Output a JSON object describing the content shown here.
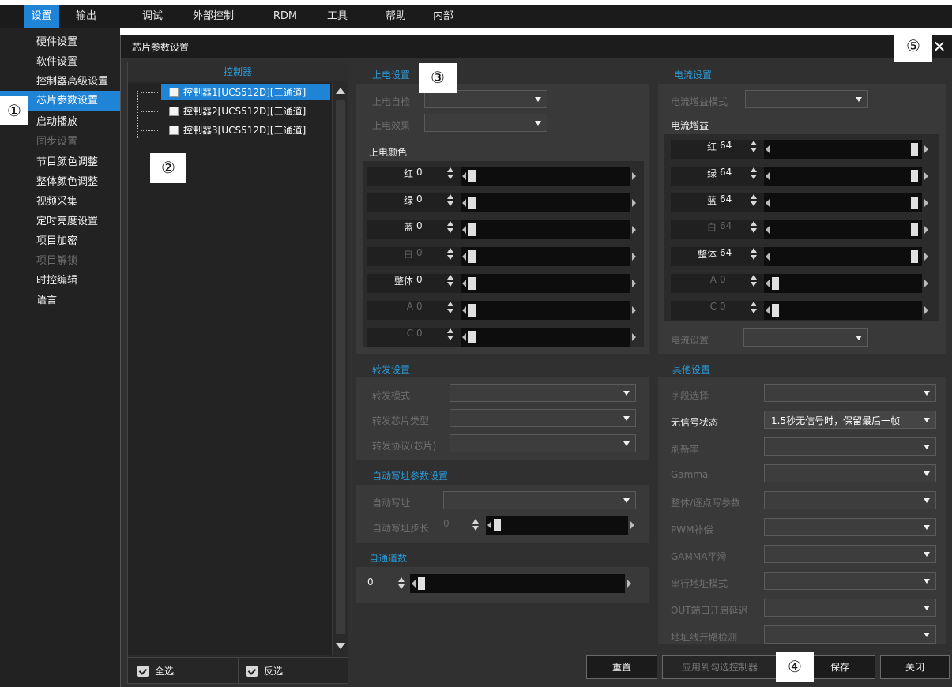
{
  "menubar": {
    "items": [
      "设置",
      "输出",
      "调试",
      "外部控制",
      "RDM",
      "工具",
      "帮助",
      "内部"
    ]
  },
  "sidebar": {
    "items": [
      {
        "label": "硬件设置",
        "state": "normal"
      },
      {
        "label": "软件设置",
        "state": "normal"
      },
      {
        "label": "控制器高级设置",
        "state": "normal"
      },
      {
        "label": "芯片参数设置",
        "state": "active"
      },
      {
        "label": "启动播放",
        "state": "normal"
      },
      {
        "label": "同步设置",
        "state": "disabled"
      },
      {
        "label": "节目颜色调整",
        "state": "normal"
      },
      {
        "label": "整体颜色调整",
        "state": "normal"
      },
      {
        "label": "视频采集",
        "state": "normal"
      },
      {
        "label": "定时亮度设置",
        "state": "normal"
      },
      {
        "label": "项目加密",
        "state": "normal"
      },
      {
        "label": "项目解锁",
        "state": "disabled"
      },
      {
        "label": "时控编辑",
        "state": "normal"
      },
      {
        "label": "语言",
        "state": "normal"
      }
    ]
  },
  "callouts": [
    "①",
    "②",
    "③",
    "④",
    "⑤"
  ],
  "dialog": {
    "title": "芯片参数设置",
    "close_glyph": "✕",
    "controllers": {
      "header": "控制器",
      "items": [
        {
          "label": "控制器1[UCS512D][三通道]",
          "selected": true
        },
        {
          "label": "控制器2[UCS512D][三通道]",
          "selected": false
        },
        {
          "label": "控制器3[UCS512D][三通道]",
          "selected": false
        }
      ],
      "select_all": "全选",
      "invert": "反选"
    },
    "power_on": {
      "title": "上电设置",
      "self_check": "上电自检",
      "effect": "上电效果",
      "color_title": "上电颜色",
      "channels": [
        {
          "name": "红",
          "value": "0",
          "enabled": true
        },
        {
          "name": "绿",
          "value": "0",
          "enabled": true
        },
        {
          "name": "蓝",
          "value": "0",
          "enabled": true
        },
        {
          "name": "白",
          "value": "0",
          "enabled": false
        },
        {
          "name": "整体",
          "value": "0",
          "enabled": true
        },
        {
          "name": "A",
          "value": "0",
          "enabled": false
        },
        {
          "name": "C",
          "value": "0",
          "enabled": false
        }
      ]
    },
    "current": {
      "title": "电流设置",
      "gain_mode": "电流增益模式",
      "gain_title": "电流增益",
      "channels": [
        {
          "name": "红",
          "value": "64",
          "enabled": true,
          "level": 1.0
        },
        {
          "name": "绿",
          "value": "64",
          "enabled": true,
          "level": 1.0
        },
        {
          "name": "蓝",
          "value": "64",
          "enabled": true,
          "level": 1.0
        },
        {
          "name": "白",
          "value": "64",
          "enabled": false,
          "level": 1.0
        },
        {
          "name": "整体",
          "value": "64",
          "enabled": true,
          "level": 1.0
        },
        {
          "name": "A",
          "value": "0",
          "enabled": false,
          "level": 0.0
        },
        {
          "name": "C",
          "value": "0",
          "enabled": false,
          "level": 0.0
        }
      ],
      "setting": "电流设置"
    },
    "forward": {
      "title": "转发设置",
      "mode": "转发模式",
      "chip_type": "转发芯片类型",
      "protocol": "转发协议(芯片)"
    },
    "auto_addr": {
      "title": "自动写址参数设置",
      "auto": "自动写址",
      "step": "自动写址步长",
      "step_value": "0"
    },
    "custom_channels": {
      "title": "自通道数",
      "value": "0"
    },
    "other": {
      "title": "其他设置",
      "rows": [
        {
          "label": "字段选择",
          "enabled": false,
          "value": ""
        },
        {
          "label": "无信号状态",
          "enabled": true,
          "value": "1.5秒无信号时，保留最后一帧"
        },
        {
          "label": "刷新率",
          "enabled": false,
          "value": ""
        },
        {
          "label": "Gamma",
          "enabled": false,
          "value": ""
        },
        {
          "label": "整体/逐点写参数",
          "enabled": false,
          "value": ""
        },
        {
          "label": "PWM补偿",
          "enabled": false,
          "value": ""
        },
        {
          "label": "GAMMA平滑",
          "enabled": false,
          "value": ""
        },
        {
          "label": "串行地址模式",
          "enabled": false,
          "value": ""
        },
        {
          "label": "OUT端口开启延迟",
          "enabled": false,
          "value": ""
        },
        {
          "label": "地址线开路检测",
          "enabled": false,
          "value": ""
        }
      ]
    },
    "buttons": {
      "reset": "重置",
      "apply": "应用到勾选控制器",
      "save": "保存",
      "close": "关闭"
    }
  }
}
